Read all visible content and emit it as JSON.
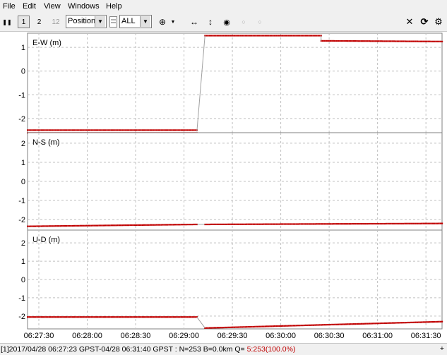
{
  "menu": [
    "File",
    "Edit",
    "View",
    "Windows",
    "Help"
  ],
  "toolbar": {
    "plot_type": "Position",
    "satellite_filter": "ALL",
    "btn_1": "1",
    "btn_2": "2",
    "btn_12": "12"
  },
  "chart_data": [
    {
      "type": "scatter",
      "title": "E-W (m)",
      "x_ticks": [
        "06:27:30",
        "06:28:00",
        "06:28:30",
        "06:29:00",
        "06:29:30",
        "06:30:00",
        "06:30:30",
        "06:31:00",
        "06:31:30"
      ],
      "y_ticks": [
        "1",
        "0",
        "-1",
        "-2"
      ],
      "ylim": [
        -2.6,
        1.6
      ],
      "series": [
        {
          "x_start": "06:27:23",
          "x_end": "06:29:08",
          "y_start": -2.55,
          "y_end": -2.55
        },
        {
          "x_start": "06:29:13",
          "x_end": "06:30:25",
          "y_start": 1.5,
          "y_end": 1.5
        },
        {
          "x_start": "06:30:25",
          "x_end": "06:31:40",
          "y_start": 1.28,
          "y_end": 1.25
        }
      ]
    },
    {
      "type": "scatter",
      "title": "N-S (m)",
      "x_ticks": [
        "06:27:30",
        "06:28:00",
        "06:28:30",
        "06:29:00",
        "06:29:30",
        "06:30:00",
        "06:30:30",
        "06:31:00",
        "06:31:30"
      ],
      "y_ticks": [
        "2",
        "1",
        "0",
        "-1",
        "-2"
      ],
      "ylim": [
        -2.55,
        2.55
      ],
      "series": [
        {
          "x_start": "06:27:23",
          "x_end": "06:29:08",
          "y_start": -2.35,
          "y_end": -2.25
        },
        {
          "x_start": "06:29:13",
          "x_end": "06:31:40",
          "y_start": -2.25,
          "y_end": -2.2
        }
      ]
    },
    {
      "type": "scatter",
      "title": "U-D (m)",
      "x_ticks": [
        "06:27:30",
        "06:28:00",
        "06:28:30",
        "06:29:00",
        "06:29:30",
        "06:30:00",
        "06:30:30",
        "06:31:00",
        "06:31:30"
      ],
      "y_ticks": [
        "2",
        "1",
        "0",
        "-1",
        "-2"
      ],
      "ylim": [
        -2.7,
        2.7
      ],
      "series": [
        {
          "x_start": "06:27:23",
          "x_end": "06:29:08",
          "y_start": -2.05,
          "y_end": -2.05
        },
        {
          "x_start": "06:29:13",
          "x_end": "06:31:40",
          "y_start": -2.65,
          "y_end": -2.3
        }
      ]
    }
  ],
  "status": {
    "text": "[1]2017/04/28 06:27:23 GPST-04/28 06:31:40 GPST : N=253 B=0.0km Q= ",
    "quality": "5:253(100.0%)"
  },
  "colors": {
    "points": "#c00000",
    "line": "#a0a0a0",
    "grid": "#c0c0c0"
  }
}
